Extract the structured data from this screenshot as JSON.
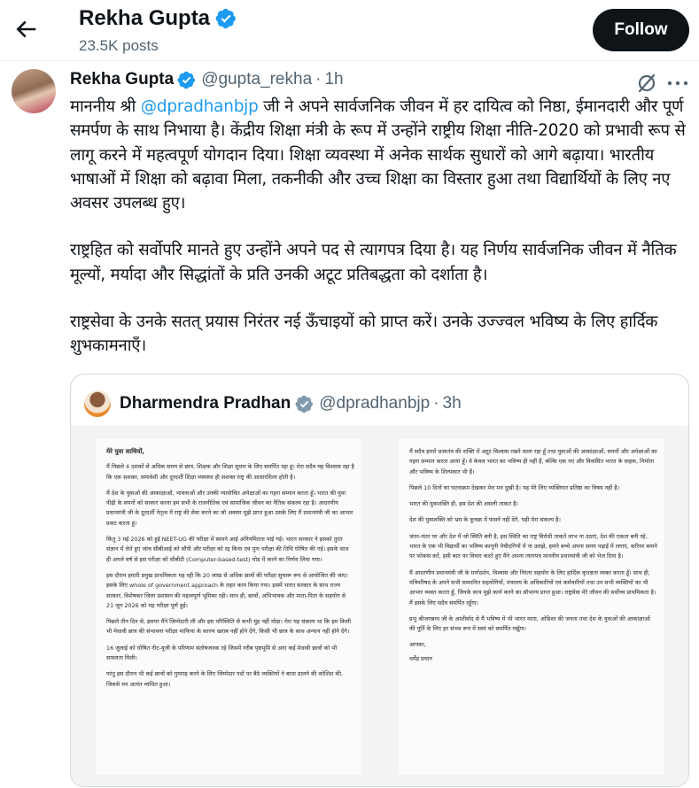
{
  "header": {
    "name": "Rekha Gupta",
    "posts_count": "23.5K posts",
    "follow_label": "Follow"
  },
  "post": {
    "author_name": "Rekha Gupta",
    "handle": "@gupta_rekha",
    "separator": "·",
    "time": "1h",
    "text_1_before": "माननीय श्री ",
    "text_1_mention": "@dpradhanbjp",
    "text_1_after": " जी ने अपने सार्वजनिक जीवन में हर दायित्व को निष्ठा, ईमानदारी और पूर्ण समर्पण के साथ निभाया है। केंद्रीय शिक्षा मंत्री के रूप में उन्होंने राष्ट्रीय शिक्षा नीति-2020 को प्रभावी रूप से लागू करने में महत्वपूर्ण योगदान दिया। शिक्षा व्यवस्था में अनेक सार्थक सुधारों को आगे बढ़ाया। भारतीय भाषाओं में शिक्षा को बढ़ावा मिला, तकनीकी और उच्च शिक्षा का विस्तार हुआ तथा विद्यार्थियों के लिए नए अवसर उपलब्ध हुए।",
    "text_2": "राष्ट्रहित को सर्वोपरि मानते हुए उन्होंने अपने पद से त्यागपत्र दिया है। यह निर्णय सार्वजनिक जीवन में नैतिक मूल्यों, मर्यादा और सिद्धांतों के प्रति उनकी अटूट प्रतिबद्धता को दर्शाता है।",
    "text_3": "राष्ट्रसेवा के उनके सतत् प्रयास निरंतर नई ऊँचाइयों को प्राप्त करें। उनके उज्ज्वल भविष्य के लिए हार्दिक शुभकामनाएँ।"
  },
  "quote": {
    "author_name": "Dharmendra Pradhan",
    "handle": "@dpradhanbjp",
    "separator": "·",
    "time": "3h",
    "letter_page1": [
      "मेरे युवा साथियों,",
      "मैं पिछले 4 दशकों से अधिक समय से छात्र, शिक्षक और शिक्षा सुधार के लिए समर्पित रहा हूं। मेरा सदैव यह विश्वास रहा है कि एक सशक्त, समावेशी और दूरदर्शी शिक्षा व्यवस्था ही सशक्त राष्ट्र की आधारशिला होती है।",
      "मैं देश के युवाओं की आकांक्षाओं, भावनाओं और उनकी न्यायोचित अपेक्षाओं का गहरा सम्मान करता हूँ। भारत की युवा पीढ़ी के सपनों को साकार करना हम सभी के राजनीतिक एवं सामाजिक जीवन का नैतिक संकल्प रहा है। आदरणीय प्रधानमंत्री जी के दूरदर्शी नेतृत्व में राष्ट्र की सेवा करने का जो अवसर मुझे प्राप्त हुआ उसके लिए मैं प्रधानमंत्री जी का आभार प्रकट करता हूं।",
      "किंतु 3 मई 2026 को हुई NEET-UG की परीक्षा में सामने आई अनियमितता पाई गई। भारत सरकार ने इसको तुरंत संज्ञान में लेते हुए जांच सीबीआई को सौंपी और परीक्षा को रद्द किया एवं पुनः परीक्षा की तिथि घोषित की गई। इसके साथ ही अगले वर्ष से इस परीक्षा को सीबीटी (Computer-based-test) मोड में करने का निर्णय लिया गया।",
      "इस दौरान हमारी प्रमुख प्राथमिकता यह रही कि 20 लाख से अधिक छात्रों की परीक्षा सुचारू रूप से आयोजित की जाए। इसके लिए whole of government approach के तहत काम किया गया। इसमें भारत सरकार के साथ राज्य सरकार, विशेषकर जिला प्रशासन की महत्वपूर्ण भूमिका रही। साथ ही, छात्रों, अभिभावक और माता-पिता के सहयोग से 21 जून 2026 को यह परीक्षा पूर्ण हुई।",
      "पिछले तीन दिन से, इसपर मैंने जिम्मेदारी ली और इस परिस्थिति से कभी मुंह नहीं मोड़ा। मेरा यह संकल्प था कि हम किसी भी मेधावी छात्र की संभावना परीक्षा माफिया के कारण खराब नहीं होने देंगे, किसी भी छात्र के साथ अन्याय नहीं होने देंगे।",
      "16 जुलाई को घोषित नीट-यूजी के परिणाम संतोषजनक रहे जिसमें गरीब पृष्ठभूमि से आए कई मेधावी छात्रों को भी सफलता मिली।",
      "परंतु इस दौरान भी कई छात्रों को गुमराह करने के लिए जिम्मेदार पदों पर बैठे व्यक्तियों ने बाधा डालने की कोशिश की, जिससे मन अत्यंत व्यथित हुआ।"
    ],
    "letter_page2": [
      "मैं सदैव हमारे प्रजातंत्र की शक्ति में अटूट विश्वास रखने वाला रहा हूँ तथा युवाओं की आकांक्षाओं, सपनों और अपेक्षाओं का गहरा सम्मान करता आया हूँ। वे केवल भारत का भविष्य ही नहीं हैं, बल्कि एक नए और विकसित भारत के वाहक, निर्माता और भविष्य के शिल्पकार भी हैं।",
      "पिछले 10 दिनों का घटनाक्रम देखकर मेरा मन दुखी है। यह मेरे लिए व्यक्तिगत प्रतिष्ठा का विषय नहीं है।",
      "भारत की युवाशक्ति ही, इस देश की असली ताकत है।",
      "देश की युवाशक्ति को भ्रम के कुचक्र में फंसने नहीं देंगे, यही मेरा संकल्प है।",
      "जंतर-मंतर पर और देश में जो स्थिति बनी है, इस स्थिति का राष्ट्र विरोधी ताकतें लाभ ना उठाएं, देश की एकता बनी रहे, भारत के एक भी विद्यार्थी का भविष्य कानूनी पेचीदगियों में ना उलझे, हमारे बच्चे अपना समय पढ़ाई में लगाएं, करियर बनाने पर फोकस करें, इसी बात पर विचार करते हुए मैंने अपना त्यागपत्र माननीय प्रधानमंत्री जी को भेज दिया है।",
      "मैं आदरणीय प्रधानमंत्री जी के मार्गदर्शन, विश्वास और निरंतर सहयोग के लिए हार्दिक कृतज्ञता व्यक्त करता हूँ। साथ ही, मंत्रिपरिषद के अपने सभी सम्मानित सहयोगियों, मंत्रालय के अधिकारियों एवं कर्मचारियों तथा उन सभी व्यक्तियों का भी आभार व्यक्त करता हूँ, जिनके साथ मुझे कार्य करने का सौभाग्य प्राप्त हुआ। राष्ट्रसेवा मेरे जीवन की सर्वोच्च प्राथमिकता है। मैं इसके लिए सदैव समर्पित रहूँगा।",
      "प्रभु श्रीजगन्नाथ जी के आशीर्वाद से मैं भविष्य में भी भारत माता, ओडिशा की जनता तथा देश के युवाओं की आकांक्षाओं की पूर्ति के लिए हर संभव रूप में स्वयं को समर्पित रखूँगा।",
      "आपका,",
      "धर्मेंद्र प्रधान"
    ]
  },
  "icons": {
    "back": "arrow-left-icon",
    "verified": "verified-badge-icon",
    "grok": "grok-icon",
    "more": "more-dots-icon"
  },
  "colors": {
    "accent": "#1d9bf0",
    "text": "#0f1419",
    "muted": "#536471",
    "follow_bg": "#0f1419"
  }
}
